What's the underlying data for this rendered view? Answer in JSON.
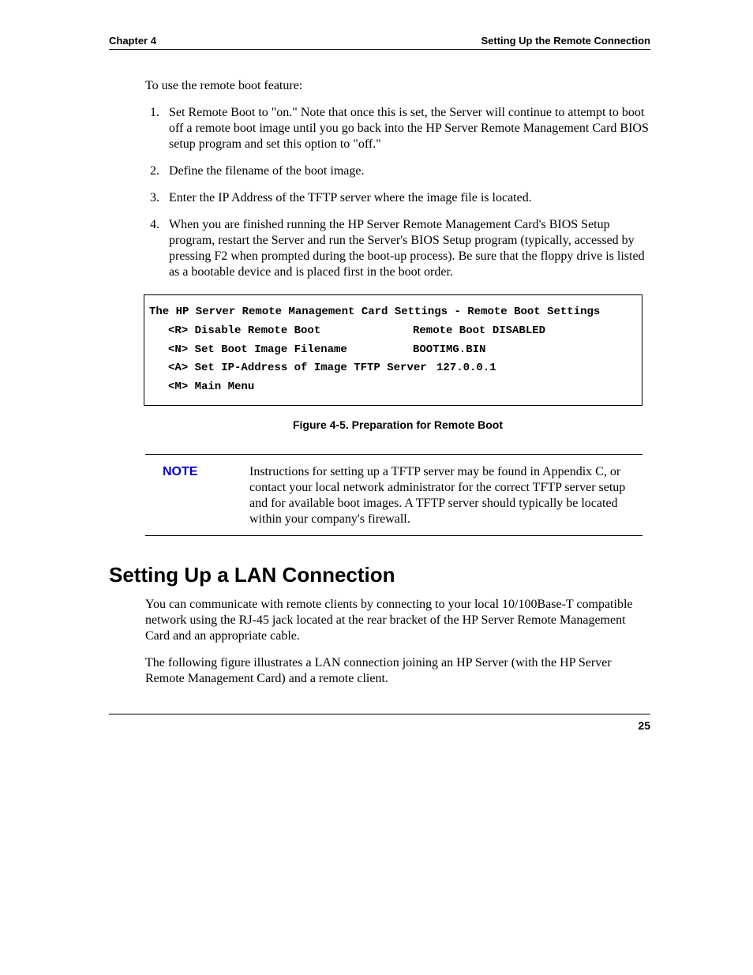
{
  "header": {
    "left": "Chapter 4",
    "right": "Setting Up the Remote Connection"
  },
  "intro": "To use the remote boot feature:",
  "steps": [
    "Set Remote Boot to \"on.\" Note that once this is set, the Server will continue to attempt to boot off a remote boot image until you go back into the HP Server Remote Management Card BIOS setup program and set this option to \"off.\"",
    "Define the filename of the boot image.",
    "Enter the IP Address of the TFTP server where the image file is located.",
    "When you are finished running the HP Server Remote Management Card's BIOS Setup program, restart the Server and run the Server's BIOS Setup program (typically, accessed by pressing F2 when prompted during the boot-up process). Be sure that the floppy drive is listed as a bootable device and is placed first in the boot order."
  ],
  "bios": {
    "title": "The HP Server Remote Management Card Settings - Remote Boot Settings",
    "rows": [
      {
        "left": "<R> Disable Remote Boot",
        "right": "Remote Boot DISABLED"
      },
      {
        "left": "<N> Set Boot Image Filename",
        "right": "BOOTIMG.BIN"
      },
      {
        "left": "<A> Set IP-Address of Image TFTP Server",
        "right": "127.0.0.1"
      },
      {
        "left": "<M> Main Menu",
        "right": ""
      }
    ]
  },
  "figure_caption": "Figure 4-5.  Preparation for Remote Boot",
  "note": {
    "label": "NOTE",
    "text": "Instructions for setting up a TFTP server may be found in Appendix C, or contact your local network administrator for the correct TFTP server setup and for available boot images. A TFTP server should typically be located within your company's firewall."
  },
  "section_heading": "Setting Up a LAN Connection",
  "paragraphs": [
    "You can communicate with remote clients by connecting to your local 10/100Base-T compatible network using the RJ-45 jack located at the rear bracket of the HP Server Remote Management Card and an appropriate cable.",
    "The following figure illustrates a LAN connection joining an HP Server (with the HP Server Remote Management Card) and a remote client."
  ],
  "page_number": "25"
}
